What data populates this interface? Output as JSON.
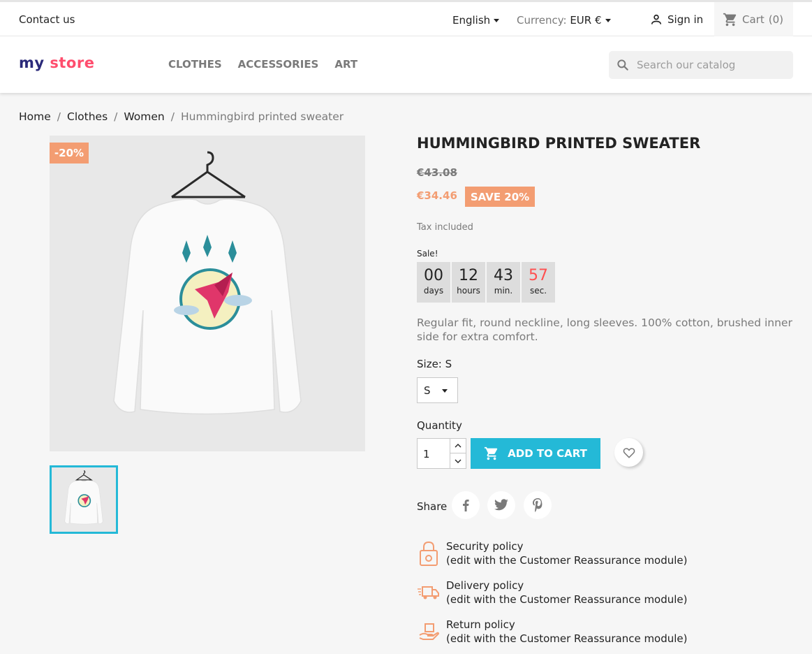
{
  "topnav": {
    "contact": "Contact us",
    "language": "English",
    "currency_label": "Currency:",
    "currency_value": "EUR €",
    "signin": "Sign in",
    "cart": "Cart",
    "cart_count": "(0)"
  },
  "header": {
    "logo_parts": [
      "my",
      "store"
    ],
    "menu": [
      "CLOTHES",
      "ACCESSORIES",
      "ART"
    ],
    "search_placeholder": "Search our catalog"
  },
  "breadcrumb": [
    "Home",
    "Clothes",
    "Women",
    "Hummingbird printed sweater"
  ],
  "product": {
    "flag": "-20%",
    "title": "HUMMINGBIRD PRINTED SWEATER",
    "regular_price": "€43.08",
    "price": "€34.46",
    "save_badge": "SAVE 20%",
    "tax": "Tax included",
    "sale_label": "Sale!",
    "countdown": [
      {
        "value": "00",
        "unit": "days"
      },
      {
        "value": "12",
        "unit": "hours"
      },
      {
        "value": "43",
        "unit": "min."
      },
      {
        "value": "57",
        "unit": "sec."
      }
    ],
    "description": "Regular fit, round neckline, long sleeves. 100% cotton, brushed inner side for extra comfort.",
    "size_label": "Size: S",
    "size_value": "S",
    "quantity_label": "Quantity",
    "quantity_value": "1",
    "add_to_cart": "ADD TO CART",
    "share_label": "Share"
  },
  "reassurance": [
    {
      "icon": "lock-icon",
      "title": "Security policy",
      "note": "(edit with the Customer Reassurance module)"
    },
    {
      "icon": "truck-icon",
      "title": "Delivery policy",
      "note": "(edit with the Customer Reassurance module)"
    },
    {
      "icon": "return-hand-icon",
      "title": "Return policy",
      "note": "(edit with the Customer Reassurance module)"
    }
  ],
  "colors": {
    "accent": "#24b9d7",
    "discount": "#f39d72",
    "countdown_seconds": "#ff4f4f"
  }
}
